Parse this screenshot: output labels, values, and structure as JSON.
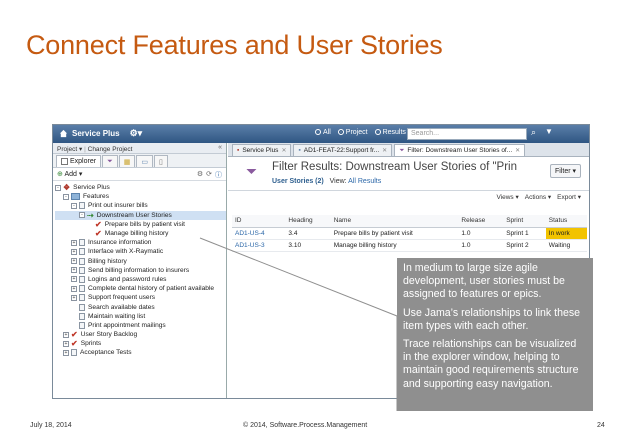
{
  "slide": {
    "title": "Connect Features and User Stories",
    "footer_date": "July 18, 2014",
    "footer_copyright": "© 2014, Software.Process.Management",
    "page_number": "24"
  },
  "app": {
    "brand": "Service Plus",
    "scope_options": [
      "All",
      "Project",
      "Results"
    ],
    "scope_selected": "Project",
    "search_placeholder": "Search..."
  },
  "left_panel": {
    "project_label": "Project ▾",
    "change_project": "Change Project",
    "explorer_tab": "Explorer",
    "add_label": "Add ▾",
    "tree": [
      {
        "label": "Service Plus",
        "depth": 0,
        "pm": "-",
        "icon": "project"
      },
      {
        "label": "Features",
        "depth": 1,
        "pm": "-",
        "icon": "folder"
      },
      {
        "label": "Print out insurer bills",
        "depth": 2,
        "pm": "-",
        "icon": "doc"
      },
      {
        "label": "Downstream User Stories",
        "depth": 3,
        "pm": "-",
        "icon": "relation",
        "selected": true
      },
      {
        "label": "Prepare bills by patient visit",
        "depth": 4,
        "pm": "",
        "icon": "check"
      },
      {
        "label": "Manage billing history",
        "depth": 4,
        "pm": "",
        "icon": "check"
      },
      {
        "label": "Insurance information",
        "depth": 2,
        "pm": "+",
        "icon": "doc"
      },
      {
        "label": "Interface with X-Raymatic",
        "depth": 2,
        "pm": "+",
        "icon": "doc"
      },
      {
        "label": "Billing history",
        "depth": 2,
        "pm": "+",
        "icon": "doc"
      },
      {
        "label": "Send billing information to insurers",
        "depth": 2,
        "pm": "+",
        "icon": "doc"
      },
      {
        "label": "Logins and password rules",
        "depth": 2,
        "pm": "+",
        "icon": "doc"
      },
      {
        "label": "Complete dental history of patient available",
        "depth": 2,
        "pm": "+",
        "icon": "doc"
      },
      {
        "label": "Support frequent users",
        "depth": 2,
        "pm": "+",
        "icon": "doc"
      },
      {
        "label": "Search available dates",
        "depth": 2,
        "pm": "",
        "icon": "doc"
      },
      {
        "label": "Maintain waiting list",
        "depth": 2,
        "pm": "",
        "icon": "doc"
      },
      {
        "label": "Print appointment mailings",
        "depth": 2,
        "pm": "",
        "icon": "doc"
      },
      {
        "label": "User Story Backlog",
        "depth": 1,
        "pm": "+",
        "icon": "check"
      },
      {
        "label": "Sprints",
        "depth": 1,
        "pm": "+",
        "icon": "check"
      },
      {
        "label": "Acceptance Tests",
        "depth": 1,
        "pm": "+",
        "icon": "doc"
      }
    ]
  },
  "right_panel": {
    "tabs": [
      {
        "label": "Service Plus"
      },
      {
        "label": "AD1-FEAT-22:Support fr..."
      },
      {
        "label": "Filter: Downstream User Stories of..."
      }
    ],
    "filter_title": "Filter Results: Downstream User Stories of \"Prin",
    "count_label": "User Stories (2)",
    "view_label": "View:",
    "view_value": "All Results",
    "filter_button": "Filter ▾",
    "views_button": "Views ▾",
    "actions_button": "Actions ▾",
    "export_button": "Export ▾",
    "table": {
      "headers": [
        "ID",
        "Heading",
        "Name",
        "Release",
        "Sprint",
        "Status"
      ],
      "rows": [
        [
          "AD1-US-4",
          "3.4",
          "Prepare bills by patient visit",
          "1.0",
          "Sprint 1",
          "In work"
        ],
        [
          "AD1-US-3",
          "3.10",
          "Manage billing history",
          "1.0",
          "Sprint 2",
          "Waiting"
        ]
      ]
    }
  },
  "callout": {
    "p1": "In medium to large size agile development, user stories must be assigned to features or epics.",
    "p2": "Use Jama’s relationships to link these item types with each other.",
    "p3": "Trace relationships can be visualized in the explorer window, helping to maintain good requirements structure and supporting easy navigation."
  },
  "colors": {
    "title": "#c55a11",
    "callout_bg": "#8f8f8f",
    "in_work": "#f2c300",
    "link": "#2b67a8"
  }
}
